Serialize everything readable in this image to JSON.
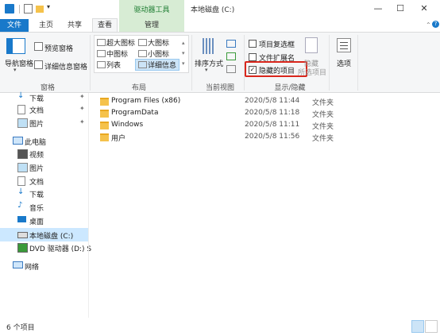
{
  "window": {
    "title": "本地磁盘 (C:)",
    "context_tab_title": "驱动器工具",
    "controls": [
      "—",
      "☐",
      "✕"
    ]
  },
  "tabs": {
    "file": "文件",
    "home": "主页",
    "share": "共享",
    "view": "查看",
    "manage": "管理"
  },
  "ribbon": {
    "panes": {
      "group_label": "窗格",
      "nav_pane": "导航窗格",
      "preview_pane": "预览窗格",
      "details_pane": "详细信息窗格"
    },
    "layout": {
      "group_label": "布局",
      "xl_icons": "超大图标",
      "large_icons": "大图标",
      "medium_icons": "中图标",
      "small_icons": "小图标",
      "list": "列表",
      "details": "详细信息"
    },
    "current_view": {
      "group_label": "当前视图",
      "sort_by": "排序方式"
    },
    "show_hide": {
      "group_label": "显示/隐藏",
      "item_checkboxes": "项目复选框",
      "file_extensions": "文件扩展名",
      "hidden_items": "隐藏的项目",
      "hide_selected": "隐藏",
      "hide_selected_2": "所选项目"
    },
    "options": "选项"
  },
  "nav": {
    "quick_access": [
      {
        "label": "下载",
        "pinned": true
      },
      {
        "label": "文档",
        "pinned": true
      },
      {
        "label": "图片",
        "pinned": true
      }
    ],
    "this_pc": "此电脑",
    "pc_items": [
      "视频",
      "图片",
      "文档",
      "下载",
      "音乐",
      "桌面",
      "本地磁盘 (C:)",
      "DVD 驱动器 (D:) S"
    ],
    "network": "网络"
  },
  "files": [
    {
      "name": "Program Files (x86)",
      "date": "2020/5/8 11:44",
      "type": "文件夹"
    },
    {
      "name": "ProgramData",
      "date": "2020/5/8 11:18",
      "type": "文件夹"
    },
    {
      "name": "Windows",
      "date": "2020/5/8 11:11",
      "type": "文件夹"
    },
    {
      "name": "用户",
      "date": "2020/5/8 11:56",
      "type": "文件夹"
    }
  ],
  "status": {
    "count": "6 个项目"
  },
  "colors": {
    "accent": "#1979ca",
    "context": "#d7ecd4",
    "highlight": "#d9261c",
    "folder": "#f5c24b"
  }
}
